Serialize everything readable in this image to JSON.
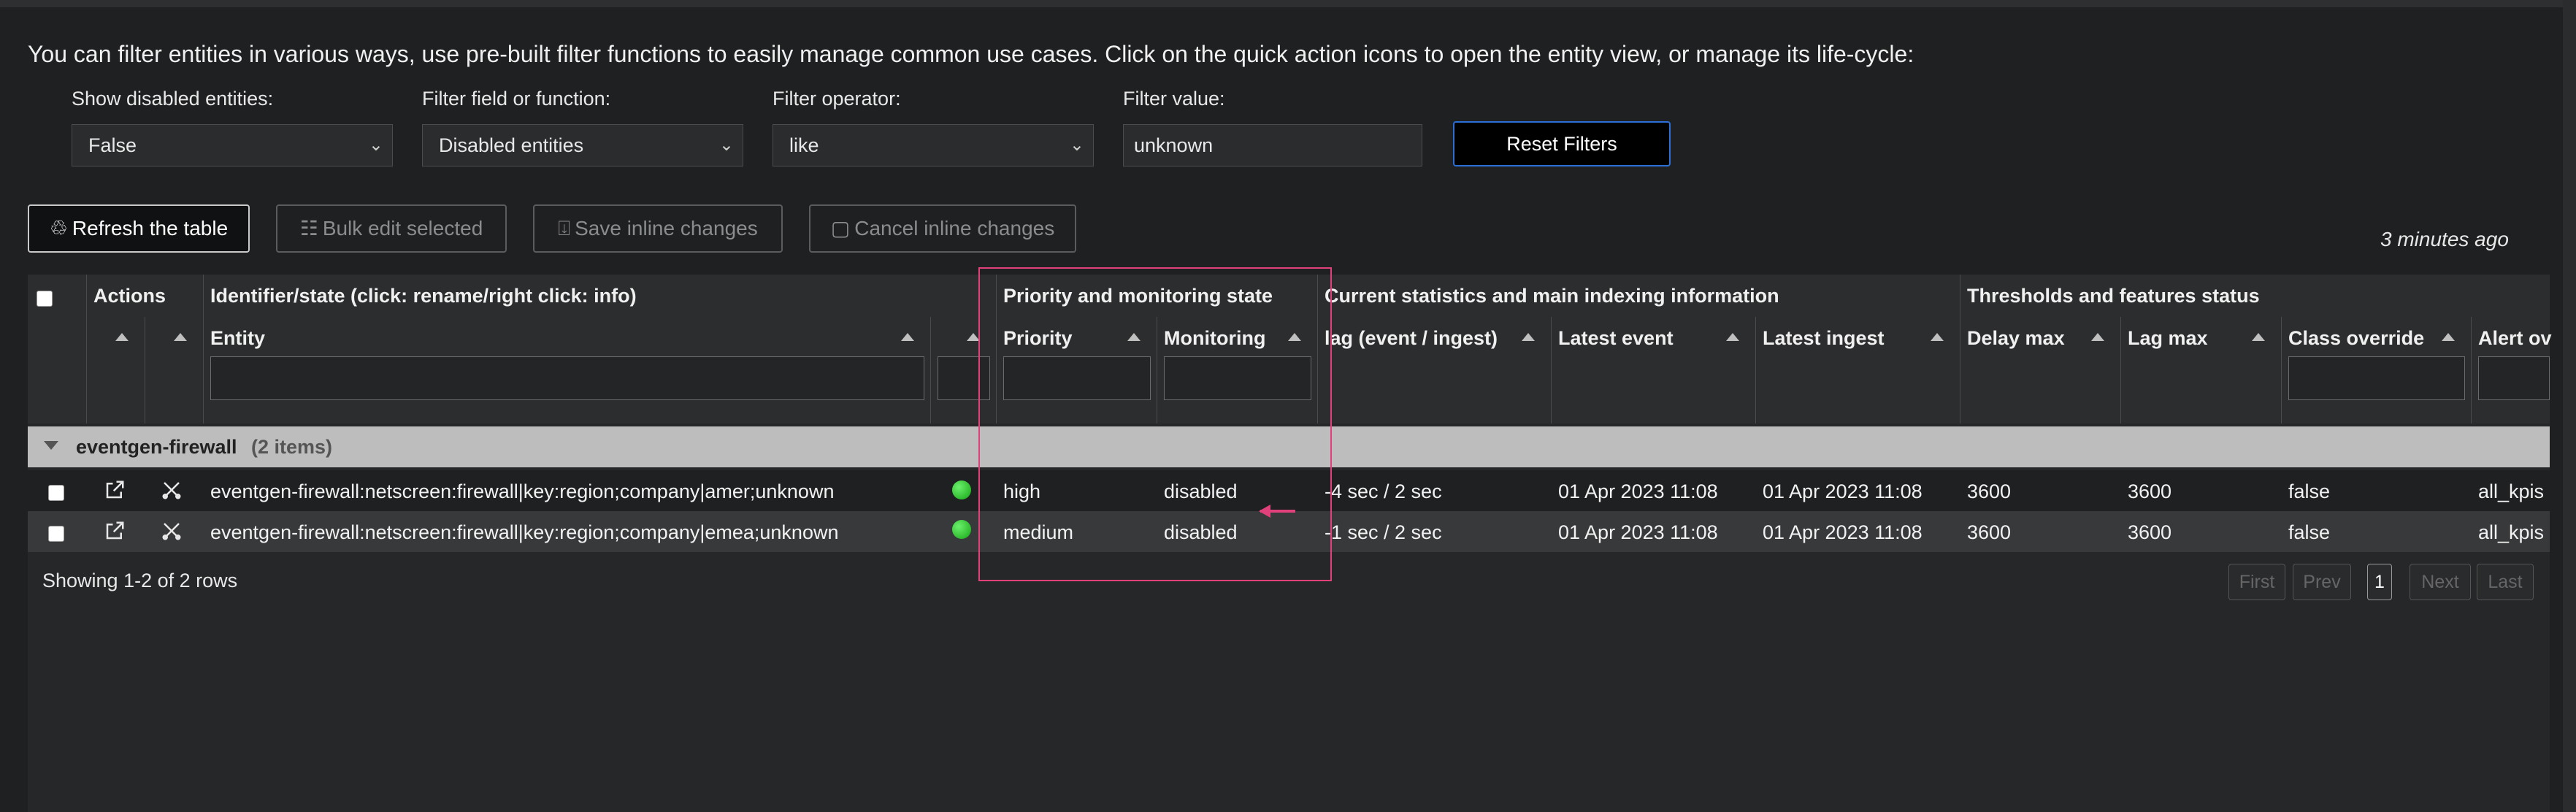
{
  "intro_text": "You can filter entities in various ways, use pre-built filter functions to easily manage common use cases. Click on the quick action icons to open the entity view, or manage its life-cycle:",
  "filters": {
    "disabled": {
      "label": "Show disabled entities:",
      "value": "False"
    },
    "field": {
      "label": "Filter field or function:",
      "value": "Disabled entities"
    },
    "operator": {
      "label": "Filter operator:",
      "value": "like"
    },
    "value": {
      "label": "Filter value:",
      "value": "unknown"
    },
    "reset_label": "Reset Filters"
  },
  "toolbar": {
    "refresh": "Refresh the table",
    "bulk_edit": "Bulk edit selected",
    "save_inline": "Save inline changes",
    "cancel_inline": "Cancel inline changes",
    "last_refresh": "3 minutes ago"
  },
  "table": {
    "group_headers": {
      "actions": "Actions",
      "identifier": "Identifier/state (click: rename/right click: info)",
      "priority_monitoring": "Priority and monitoring state",
      "statistics": "Current statistics and main indexing information",
      "thresholds": "Thresholds and features status"
    },
    "columns": {
      "entity": "Entity",
      "priority": "Priority",
      "monitoring": "Monitoring",
      "lag": "lag (event / ingest)",
      "latest_event": "Latest event",
      "latest_ingest": "Latest ingest",
      "delay_max": "Delay max",
      "lag_max": "Lag max",
      "class_override": "Class override",
      "alert": "Alert ov"
    },
    "group": {
      "name": "eventgen-firewall",
      "count": "(2 items)"
    },
    "rows": [
      {
        "entity": "eventgen-firewall:netscreen:firewall|key:region;company|amer;unknown",
        "status_color": "#1fbf1f",
        "priority": "high",
        "monitoring": "disabled",
        "lag": "-4 sec / 2 sec",
        "latest_event": "01 Apr 2023 11:08",
        "latest_ingest": "01 Apr 2023 11:08",
        "delay_max": "3600",
        "lag_max": "3600",
        "class_override": "false",
        "alert": "all_kpis"
      },
      {
        "entity": "eventgen-firewall:netscreen:firewall|key:region;company|emea;unknown",
        "status_color": "#1fbf1f",
        "priority": "medium",
        "monitoring": "disabled",
        "lag": "-1 sec / 2 sec",
        "latest_event": "01 Apr 2023 11:08",
        "latest_ingest": "01 Apr 2023 11:08",
        "delay_max": "3600",
        "lag_max": "3600",
        "class_override": "false",
        "alert": "all_kpis"
      }
    ],
    "showing": "Showing 1-2 of 2 rows"
  },
  "pagination": {
    "first": "First",
    "prev": "Prev",
    "current": "1",
    "next": "Next",
    "last": "Last"
  },
  "colors": {
    "highlight": "#e0417a",
    "accent_blue": "#2b6fd6",
    "status_green": "#1fbf1f"
  },
  "icons": [
    "refresh-icon",
    "sliders-icon",
    "save-icon",
    "cancel-icon",
    "external-link-icon",
    "tools-icon",
    "chevron-down-icon",
    "sort-asc-icon",
    "arrow-left-icon"
  ]
}
